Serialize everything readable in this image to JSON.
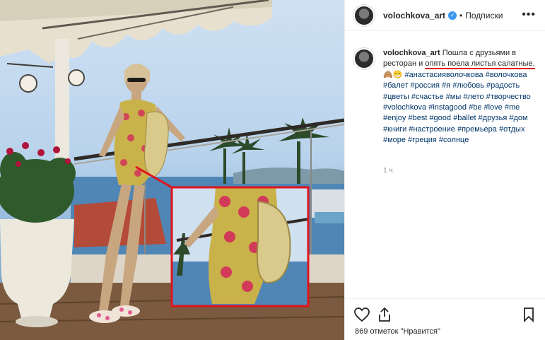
{
  "post": {
    "username": "volochkova_art",
    "verified_mark": "✓",
    "separator": "•",
    "follow_label": "Подписки",
    "more_label": "•••"
  },
  "caption": {
    "username": "volochkova_art",
    "text_a": "Пошла с друзьями в ресторан и ",
    "text_b": "опять поела листья салатные.",
    "emoji": " 🙈😁 ",
    "hashtags": "#анастасияволочкова #волочкова #балет #россия #я #любовь #радость #цветы #счастье #мы #лето #творчество #volochkova #instagood #be #love #me #enjoy #best #good #ballet #друзья #дом #книги #настроение #премьера #отдых #море #греция #солнце",
    "time": "1 ч."
  },
  "actions": {
    "likes_text": "869 отметок \"Нравится\""
  },
  "icons": {
    "like": "heart-icon",
    "share": "share-icon",
    "save": "bookmark-icon",
    "more": "more-icon",
    "verified": "verified-badge-icon"
  },
  "colors": {
    "highlight_red": "#e0131d",
    "link_blue": "#003569",
    "verified_blue": "#3897f0",
    "muted": "#8e8e8e"
  }
}
